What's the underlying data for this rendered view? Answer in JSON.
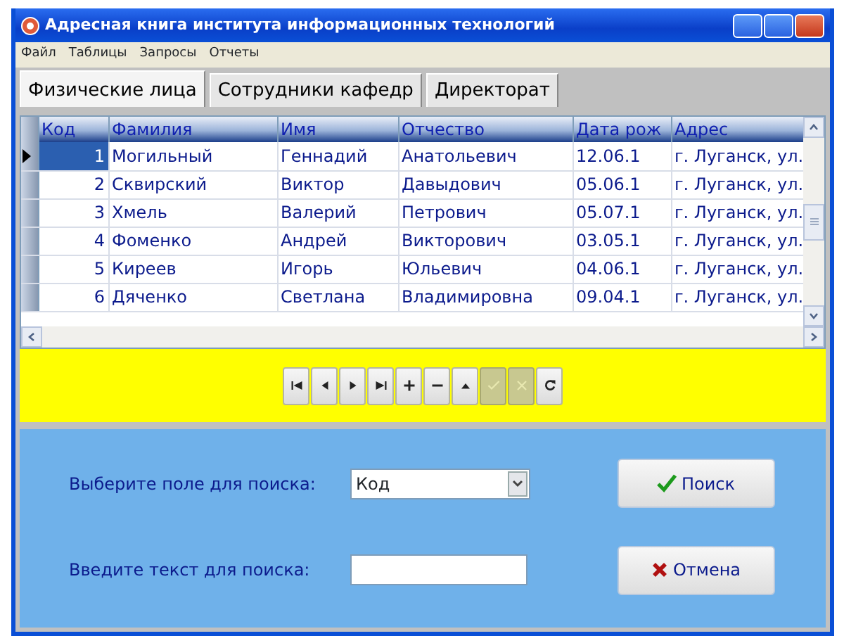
{
  "window": {
    "title": "Адресная книга института информационных технологий"
  },
  "menu": [
    "Файл",
    "Таблицы",
    "Запросы",
    "Отчеты"
  ],
  "tabs": [
    {
      "label": "Физические лица",
      "selected": true
    },
    {
      "label": "Сотрудники кафедр",
      "selected": false
    },
    {
      "label": "Директорат",
      "selected": false
    }
  ],
  "table": {
    "columns": [
      "Код",
      "Фамилия",
      "Имя",
      "Отчество",
      "Дата рож",
      "Адрес"
    ],
    "rows": [
      {
        "selected": true,
        "cells": [
          "1",
          "Могильный",
          "Геннадий",
          "Анатольевич",
          "12.06.1",
          "г. Луганск, ул."
        ]
      },
      {
        "selected": false,
        "cells": [
          "2",
          "Сквирский",
          "Виктор",
          "Давыдович",
          "05.06.1",
          "г. Луганск, ул."
        ]
      },
      {
        "selected": false,
        "cells": [
          "3",
          "Хмель",
          "Валерий",
          "Петрович",
          "05.07.1",
          "г. Луганск, ул."
        ]
      },
      {
        "selected": false,
        "cells": [
          "4",
          "Фоменко",
          "Андрей",
          "Викторович",
          "03.05.1",
          "г. Луганск, ул."
        ]
      },
      {
        "selected": false,
        "cells": [
          "5",
          "Киреев",
          "Игорь",
          "Юльевич",
          "04.06.1",
          "г. Луганск, ул."
        ]
      },
      {
        "selected": false,
        "cells": [
          "6",
          "Дяченко",
          "Светлана",
          "Владимировна",
          "09.04.1",
          "г. Луганск, ул."
        ]
      }
    ]
  },
  "navigator": [
    {
      "kind": "first",
      "disabled": false
    },
    {
      "kind": "prior",
      "disabled": false
    },
    {
      "kind": "next",
      "disabled": false
    },
    {
      "kind": "last",
      "disabled": false
    },
    {
      "kind": "insert",
      "disabled": false
    },
    {
      "kind": "delete",
      "disabled": false
    },
    {
      "kind": "edit",
      "disabled": false
    },
    {
      "kind": "post",
      "disabled": true
    },
    {
      "kind": "cancel",
      "disabled": true
    },
    {
      "kind": "refresh",
      "disabled": false
    }
  ],
  "search": {
    "field_label": "Выберите поле для поиска:",
    "field_value": "Код",
    "text_label": "Введите текст для поиска:",
    "buttons": [
      {
        "kind": "search",
        "label": "Поиск"
      },
      {
        "kind": "cancel",
        "label": "Отмена"
      }
    ]
  }
}
